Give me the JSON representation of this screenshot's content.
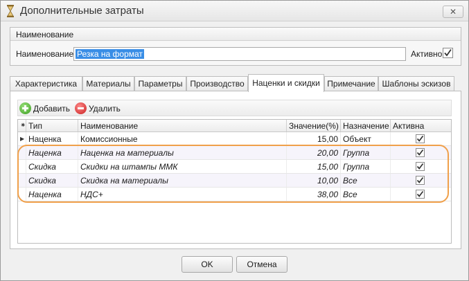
{
  "window": {
    "title": "Дополнительные затраты",
    "close_symbol": "✕"
  },
  "name_group": {
    "title": "Наименование",
    "field_label": "Наименование:",
    "field_value": "Резка на формат",
    "active_label": "Активно",
    "active_checked": true
  },
  "tabs": [
    {
      "label": "Характеристика",
      "active": false
    },
    {
      "label": "Материалы",
      "active": false
    },
    {
      "label": "Параметры",
      "active": false
    },
    {
      "label": "Производство",
      "active": false
    },
    {
      "label": "Наценки и скидки",
      "active": true
    },
    {
      "label": "Примечание",
      "active": false
    },
    {
      "label": "Шаблоны эскизов",
      "active": false
    }
  ],
  "toolbar": {
    "add_label": "Добавить",
    "delete_label": "Удалить"
  },
  "grid": {
    "headers": {
      "indicator": "⁕",
      "type": "Тип",
      "name": "Наименование",
      "value": "Значение(%)",
      "target": "Назначение",
      "active": "Активна"
    },
    "rows": [
      {
        "type": "Наценка",
        "name": "Комиссионные",
        "value": "15,00",
        "target": "Объект",
        "active": true,
        "italic": false,
        "current": true
      },
      {
        "type": "Наценка",
        "name": "Наценка на материалы",
        "value": "20,00",
        "target": "Группа",
        "active": true,
        "italic": true,
        "current": false
      },
      {
        "type": "Скидка",
        "name": "Скидки на штампы ММК",
        "value": "15,00",
        "target": "Группа",
        "active": true,
        "italic": true,
        "current": false
      },
      {
        "type": "Скидка",
        "name": "Скидка на материалы",
        "value": "10,00",
        "target": "Все",
        "active": true,
        "italic": true,
        "current": false
      },
      {
        "type": "Наценка",
        "name": "НДС+",
        "value": "38,00",
        "target": "Все",
        "active": true,
        "italic": true,
        "current": false
      }
    ]
  },
  "footer": {
    "ok_label": "OK",
    "cancel_label": "Отмена"
  },
  "colors": {
    "highlight": "#f0a04a",
    "selection": "#3a8ee6"
  }
}
